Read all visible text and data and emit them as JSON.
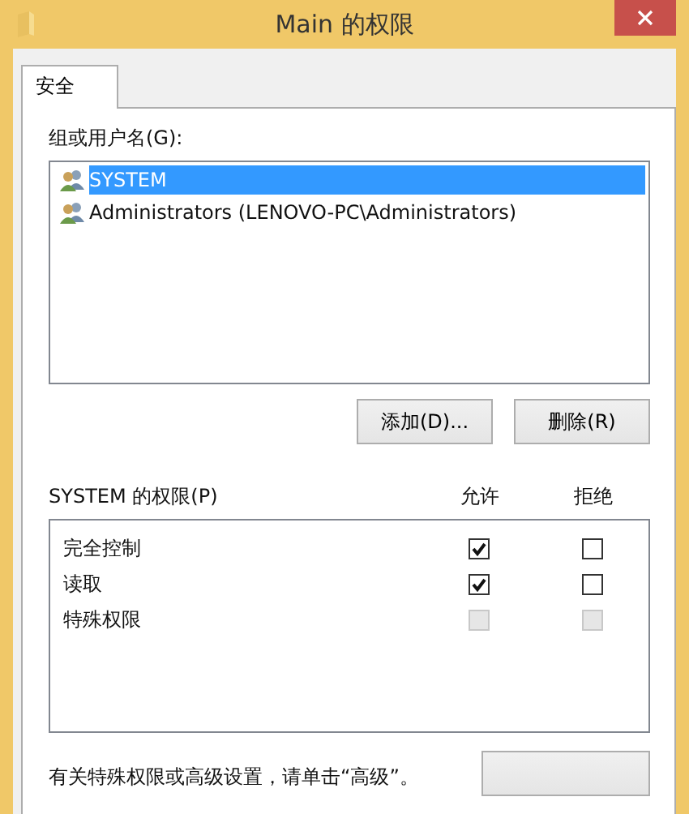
{
  "window": {
    "title": "Main 的权限"
  },
  "tabs": [
    {
      "label": "安全",
      "selected": true
    }
  ],
  "users": {
    "label": "组或用户名(G):",
    "items": [
      {
        "name": "SYSTEM",
        "selected": true
      },
      {
        "name": "Administrators (LENOVO-PC\\Administrators)",
        "selected": false
      }
    ]
  },
  "buttons": [
    "添加(D)...",
    "删除(R)"
  ],
  "permissions": {
    "label": "SYSTEM 的权限(P)",
    "columns": [
      "允许",
      "拒绝"
    ],
    "rows": [
      {
        "name": "完全控制",
        "allow": {
          "checked": true,
          "disabled": false
        },
        "deny": {
          "checked": false,
          "disabled": false
        }
      },
      {
        "name": "读取",
        "allow": {
          "checked": true,
          "disabled": false
        },
        "deny": {
          "checked": false,
          "disabled": false
        }
      },
      {
        "name": "特殊权限",
        "allow": {
          "checked": false,
          "disabled": true
        },
        "deny": {
          "checked": false,
          "disabled": true
        }
      }
    ]
  },
  "footer": {
    "text": "有关特殊权限或高级设置，请单击“高级”。"
  }
}
